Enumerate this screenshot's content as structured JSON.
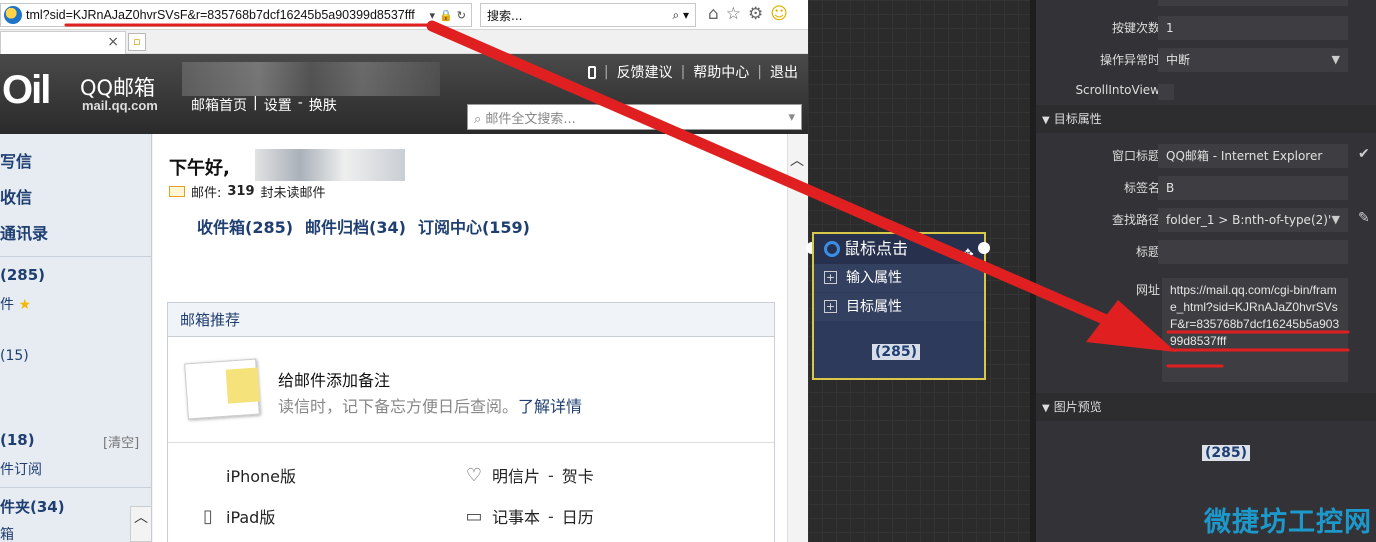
{
  "browser": {
    "address": "tml?sid=KJRnAJaZ0hvrSVsF&r=835768b7dcf16245b5a90399d8537fff",
    "search_placeholder": "搜索...",
    "tab_close": "×"
  },
  "qq": {
    "logo": "Oil",
    "brand": "QQ邮箱",
    "domain": "mail.qq.com",
    "top_links": [
      "反馈建议",
      "帮助中心",
      "退出"
    ],
    "nav": [
      "邮箱首页",
      "设置",
      "换肤"
    ],
    "search_placeholder": "邮件全文搜索..."
  },
  "sidebar": {
    "write": "写信",
    "receive": "收信",
    "contacts": "通讯录",
    "inbox_count": "(285)",
    "star_label": "件",
    "count15": "(15)",
    "count18": "(18)",
    "clear": "[清空]",
    "subscribe": "件订阅",
    "archive": "件夹(34)",
    "box": "箱"
  },
  "main": {
    "greeting": "下午好,",
    "unread_label": "邮件:",
    "unread_count": "319",
    "unread_suffix": "封未读邮件",
    "folders": [
      "收件箱(285)",
      "邮件归档(34)",
      "订阅中心(159)"
    ],
    "rec_header": "邮箱推荐",
    "rec_title": "给邮件添加备注",
    "rec_desc": "读信时，记下备忘方便日后查阅。",
    "rec_link": "了解详情",
    "apps": [
      {
        "label": "iPhone版",
        "icon": "apple-icon"
      },
      {
        "label": "明信片",
        "extra": "贺卡",
        "icon": "heart-icon"
      },
      {
        "label": "iPad版",
        "icon": "tablet-icon"
      },
      {
        "label": "记事本",
        "extra": "日历",
        "icon": "calendar-icon"
      }
    ]
  },
  "node": {
    "title": "鼠标点击",
    "rows": [
      "输入属性",
      "目标属性"
    ],
    "image_text": "285"
  },
  "panel": {
    "key_count_label": "按键次数",
    "key_count_value": "1",
    "on_error_label": "操作异常时",
    "on_error_value": "中断",
    "scroll_label": "ScrollIntoView",
    "target_section": "目标属性",
    "window_title_label": "窗口标题",
    "window_title_value": "QQ邮箱 - Internet Explorer",
    "tag_label": "标签名",
    "tag_value": "B",
    "path_label": "查找路径",
    "path_value": "folder_1 > B:nth-of-type(2)'",
    "title_label": "标题",
    "title_value": "",
    "url_label": "网址",
    "url_value": "https://mail.qq.com/cgi-bin/frame_html?sid=KJRnAJaZ0hvrSVsF&r=835768b7dcf16245b5a90399d8537fff",
    "preview_section": "图片预览",
    "preview_text": "285",
    "watermark": "微捷坊工控网"
  },
  "colors": {
    "annotation_red": "#e02020",
    "accent_blue": "#1f3f72",
    "node_border": "#d8c84a"
  }
}
